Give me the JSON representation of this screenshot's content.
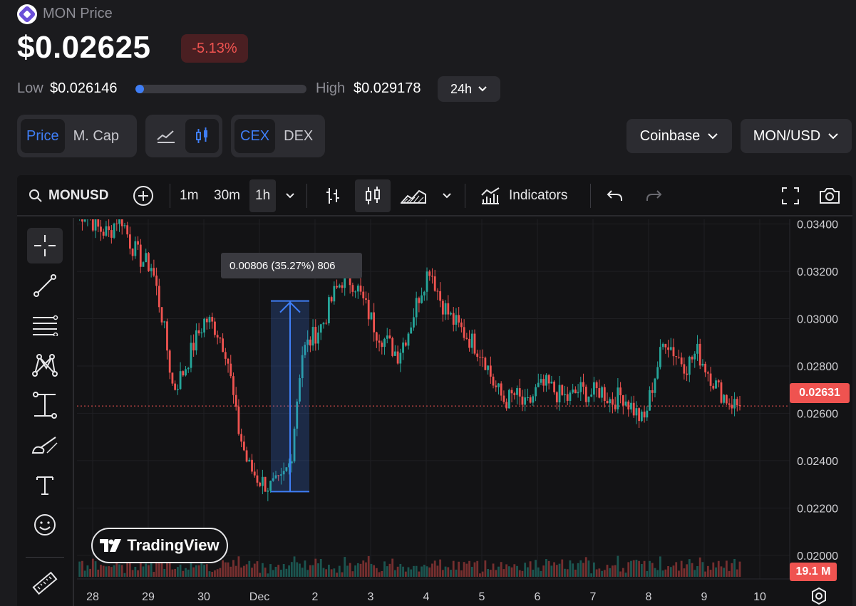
{
  "header": {
    "coin_title": "MON Price",
    "price": "$0.02625",
    "change": "-5.13%",
    "low_label": "Low",
    "low_value": "$0.026146",
    "high_label": "High",
    "high_value": "$0.029178",
    "range_position": 0.03,
    "period": "24h"
  },
  "toggles": {
    "price": "Price",
    "mcap": "M. Cap",
    "cex": "CEX",
    "dex": "DEX"
  },
  "dropdowns": {
    "exchange": "Coinbase",
    "pair": "MON/USD"
  },
  "toolbar": {
    "symbol": "MONUSD",
    "tf_1m": "1m",
    "tf_30m": "30m",
    "tf_1h": "1h",
    "indicators": "Indicators"
  },
  "chart": {
    "measure_label": "0.00806 (35.27%) 806",
    "last_price_label": "0.02631",
    "volume_label": "19.1 M",
    "branding": "TradingView",
    "y_ticks": [
      "0.03400",
      "0.03200",
      "0.03000",
      "0.02800",
      "0.02600",
      "0.02400",
      "0.02200",
      "0.02000"
    ],
    "x_ticks": [
      "28",
      "29",
      "30",
      "Dec",
      "2",
      "3",
      "4",
      "5",
      "6",
      "7",
      "8",
      "9",
      "10"
    ],
    "up_color": "#26a69a",
    "down_color": "#ef5350",
    "accent_color": "#3f7ef6"
  },
  "chart_data": {
    "type": "candlestick",
    "ylim": [
      0.019,
      0.0342
    ],
    "x": [
      "28",
      "29",
      "30",
      "Dec",
      "2",
      "3",
      "4",
      "5",
      "6",
      "7",
      "8",
      "9",
      "10"
    ],
    "close_path": [
      0.0345,
      0.0344,
      0.0338,
      0.0336,
      0.0345,
      0.0332,
      0.0325,
      0.0322,
      0.03,
      0.027,
      0.0278,
      0.029,
      0.03,
      0.0296,
      0.0286,
      0.0255,
      0.0238,
      0.0232,
      0.0229,
      0.023,
      0.024,
      0.0285,
      0.0292,
      0.0298,
      0.031,
      0.0318,
      0.0315,
      0.0305,
      0.0295,
      0.029,
      0.0285,
      0.0295,
      0.031,
      0.0322,
      0.0308,
      0.03,
      0.0295,
      0.029,
      0.0285,
      0.0272,
      0.0265,
      0.0268,
      0.0262,
      0.027,
      0.0272,
      0.0268,
      0.0266,
      0.027,
      0.0268,
      0.027,
      0.0265,
      0.0268,
      0.0262,
      0.0256,
      0.0275,
      0.0292,
      0.0285,
      0.028,
      0.0286,
      0.0278,
      0.027,
      0.0265,
      0.0263
    ],
    "last_price": 0.02631,
    "last_volume": "19.1 M"
  }
}
